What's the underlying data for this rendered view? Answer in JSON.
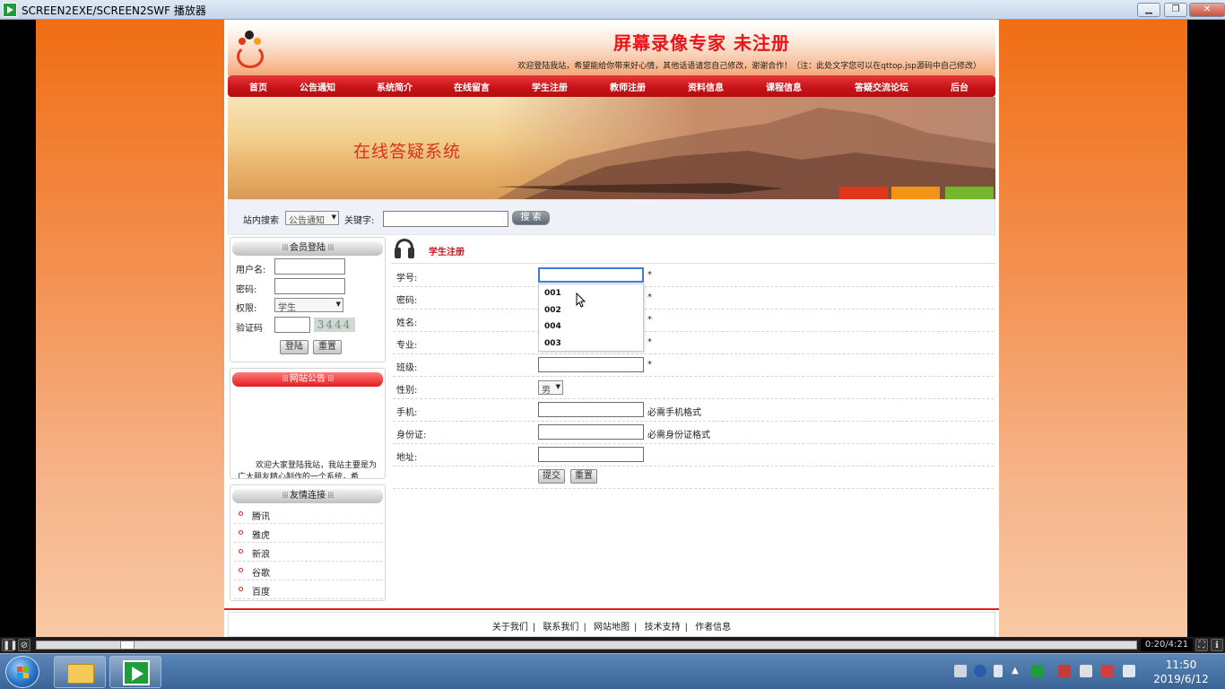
{
  "window": {
    "title": "SCREEN2EXE/SCREEN2SWF 播放器"
  },
  "site": {
    "title": "屏幕录像专家 未注册",
    "welcome": "欢迎登陆我站，希望能给你带来好心情，其他话语请您自己修改，谢谢合作！（注：此处文字您可以在qttop.jsp源码中自己修改）",
    "banner_title": "在线答疑系统"
  },
  "nav": [
    "首页",
    "公告通知",
    "系统简介",
    "在线留言",
    "学生注册",
    "教师注册",
    "资料信息",
    "课程信息",
    "答疑交流论坛",
    "后台"
  ],
  "search": {
    "label": "站内搜索",
    "category": "公告通知",
    "keyword_label": "关键字:",
    "button": "搜 索"
  },
  "login": {
    "title": "会员登陆",
    "username_label": "用户名:",
    "password_label": "密码:",
    "role_label": "权限:",
    "role_value": "学生",
    "captcha_label": "验证码",
    "captcha": "3444",
    "login_button": "登陆",
    "reset_button": "重置"
  },
  "notice": {
    "title": "网站公告",
    "text": "欢迎大家登陆我站，我站主要是为广大朋友精心制作的一个系统，希"
  },
  "links": {
    "title": "友情连接",
    "items": [
      "腾讯",
      "雅虎",
      "新浪",
      "谷歌",
      "百度"
    ]
  },
  "register": {
    "title": "学生注册",
    "fields": [
      {
        "label": "学号:",
        "suffix": "*"
      },
      {
        "label": "密码:",
        "suffix": "*"
      },
      {
        "label": "姓名:",
        "suffix": "*"
      },
      {
        "label": "专业:",
        "suffix": "*"
      },
      {
        "label": "班级:",
        "suffix": "*"
      },
      {
        "label": "性别:",
        "suffix": ""
      },
      {
        "label": "手机:",
        "suffix": "必需手机格式"
      },
      {
        "label": "身份证:",
        "suffix": "必需身份证格式"
      },
      {
        "label": "地址:",
        "suffix": ""
      }
    ],
    "gender_value": "男",
    "autocomplete": [
      "001",
      "002",
      "004",
      "003"
    ],
    "submit_button": "提交",
    "reset_button": "重置"
  },
  "footer": [
    "关于我们",
    "联系我们",
    "网站地图",
    "技术支持",
    "作者信息"
  ],
  "player": {
    "time": "0:20/4:21",
    "progress": 0.077
  },
  "taskbar": {
    "time": "11:50",
    "date": "2019/6/12"
  },
  "colors": {
    "nav_red": "#c51216",
    "title_red": "#e8151a",
    "page_orange": "#f06e14"
  }
}
